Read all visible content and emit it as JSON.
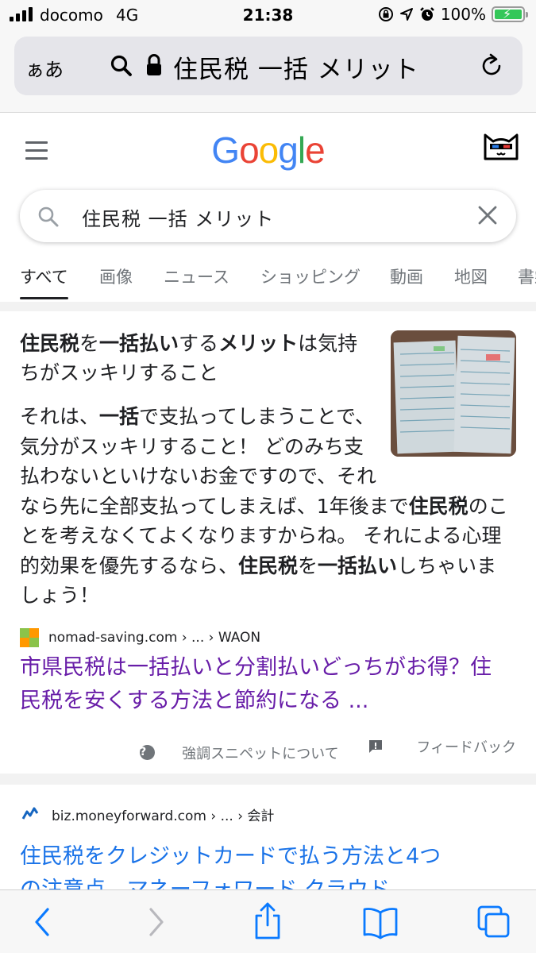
{
  "status": {
    "carrier": "docomo",
    "network": "4G",
    "time": "21:38",
    "battery": "100%"
  },
  "address_bar": {
    "reader_label": "ぁあ",
    "query": "住民税 一括 メリット"
  },
  "google": {
    "logo": [
      "G",
      "o",
      "o",
      "g",
      "l",
      "e"
    ],
    "logo_colors": [
      "#4285f4",
      "#ea4335",
      "#fbbc05",
      "#4285f4",
      "#34a853",
      "#ea4335"
    ],
    "search_value": "住民税 一括 メリット",
    "tabs": [
      "すべて",
      "画像",
      "ニュース",
      "ショッピング",
      "動画",
      "地図",
      "書籍"
    ]
  },
  "featured": {
    "title_parts": [
      {
        "t": "住民税",
        "b": true
      },
      {
        "t": "を",
        "b": false
      },
      {
        "t": "一括払い",
        "b": true
      },
      {
        "t": "する",
        "b": false
      },
      {
        "t": "メリット",
        "b": true
      },
      {
        "t": "は気持ちがスッキリすること",
        "b": false
      }
    ],
    "body_parts": [
      {
        "t": "それは、",
        "b": false
      },
      {
        "t": "一括",
        "b": true
      },
      {
        "t": "で支払ってしまうことで、気分がスッキリすること！ どのみち支払わないといけないお金ですので、それなら先に全部支払ってしまえば、1年後まで",
        "b": false
      },
      {
        "t": "住民税",
        "b": true
      },
      {
        "t": "のことを考えなくてよくなりますからね。 それによる心理的効果を優先するなら、",
        "b": false
      },
      {
        "t": "住民税",
        "b": true
      },
      {
        "t": "を",
        "b": false
      },
      {
        "t": "一括払い",
        "b": true
      },
      {
        "t": "しちゃいましょう！",
        "b": false
      }
    ],
    "source": "nomad-saving.com › ... › WAON",
    "result_title": "市県民税は一括払いと分割払いどっちがお得？住民税を安くする方法と節約になる ...",
    "about_label": "強調スニペットについて",
    "feedback_label": "フィードバック"
  },
  "second": {
    "source": "biz.moneyforward.com › ... › 会計",
    "title_line1": "住民税をクレジットカードで払う方法と4つ",
    "title_line2": "の注意点 - マネーフォワード クラウド"
  },
  "colors": {
    "visited_link": "#681da8",
    "link": "#1a73e8",
    "safari_blue": "#0a7aff",
    "battery_green": "#34c759"
  }
}
